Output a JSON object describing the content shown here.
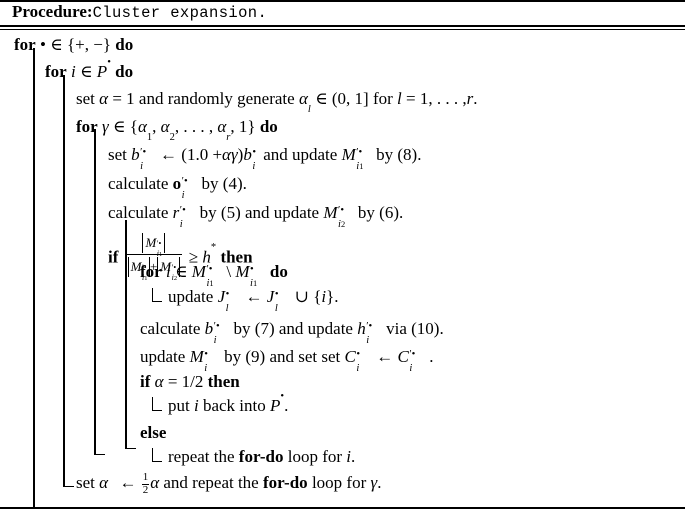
{
  "header": {
    "keyword": "Procedure:",
    "name": "Cluster expansion."
  },
  "lines": {
    "l1": {
      "kw1": "for",
      "body": "• ∈ {+, −}",
      "kw2": "do"
    },
    "l2": {
      "kw1": "for",
      "var": "i",
      "in": "∈",
      "set": "P",
      "kw2": "do"
    },
    "l3": {
      "text_a": "set",
      "text_b": "= 1 and randomly generate",
      "text_c": "∈ (0, 1] for",
      "text_d": "= 1,",
      "text_e": ".",
      "alpha": "α",
      "alpha_l": "α",
      "l": "l",
      "r": "r"
    },
    "l4": {
      "kw1": "for",
      "gamma": "γ",
      "in": "∈",
      "seq": "{α1, α2, … , αr, 1}",
      "kw2": "do"
    },
    "l5": {
      "a": "set",
      "b": "← (1.0 +",
      "c": ")",
      "d": "and update",
      "e": "by (8)."
    },
    "l6": {
      "a": "calculate",
      "b": "by (4)."
    },
    "l7": {
      "a": "calculate",
      "b": "by (5) and update",
      "c": "by (6)."
    },
    "l8": {
      "kw1": "if",
      "op": "≥",
      "h": "h",
      "star": "*",
      "kw2": "then"
    },
    "l9": {
      "kw1": "for",
      "var": "l",
      "in": "∈",
      "minus": "\\",
      "kw2": "do"
    },
    "l10": {
      "a": "update",
      "b": "←",
      "c": "∪ {i}."
    },
    "l11": {
      "a": "calculate",
      "b": "by (7) and update",
      "c": "via (10)."
    },
    "l12": {
      "a": "update",
      "b": "by (9) and set set",
      "c": "←",
      "d": "."
    },
    "l13": {
      "kw1": "if",
      "alpha": "α",
      "cond": "= 1/2",
      "kw2": "then"
    },
    "l14": {
      "a": "put",
      "i": "i",
      "b": "back into",
      "P": "P",
      "c": "."
    },
    "l15": {
      "kw": "else"
    },
    "l16": {
      "a": "repeat the",
      "kw": "for-do",
      "b": "loop for",
      "i": "i",
      "c": "."
    },
    "l17": {
      "a": "set",
      "alpha": "α",
      "arrow": "←",
      "num": "1",
      "den": "2",
      "b": "and repeat the",
      "kw": "for-do",
      "c": "loop for",
      "gamma": "γ",
      "d": "."
    }
  },
  "symbols": {
    "bullet": "•",
    "prime": "′",
    "M": "M",
    "b": "b",
    "o": "o",
    "r": "r",
    "h": "h",
    "J": "J",
    "C": "C",
    "P": "P",
    "i": "i",
    "l": "l",
    "sub1": "1",
    "sub2": "2",
    "plus": "+"
  },
  "colors": {
    "ink": "#000000",
    "paper": "#ffffff"
  }
}
